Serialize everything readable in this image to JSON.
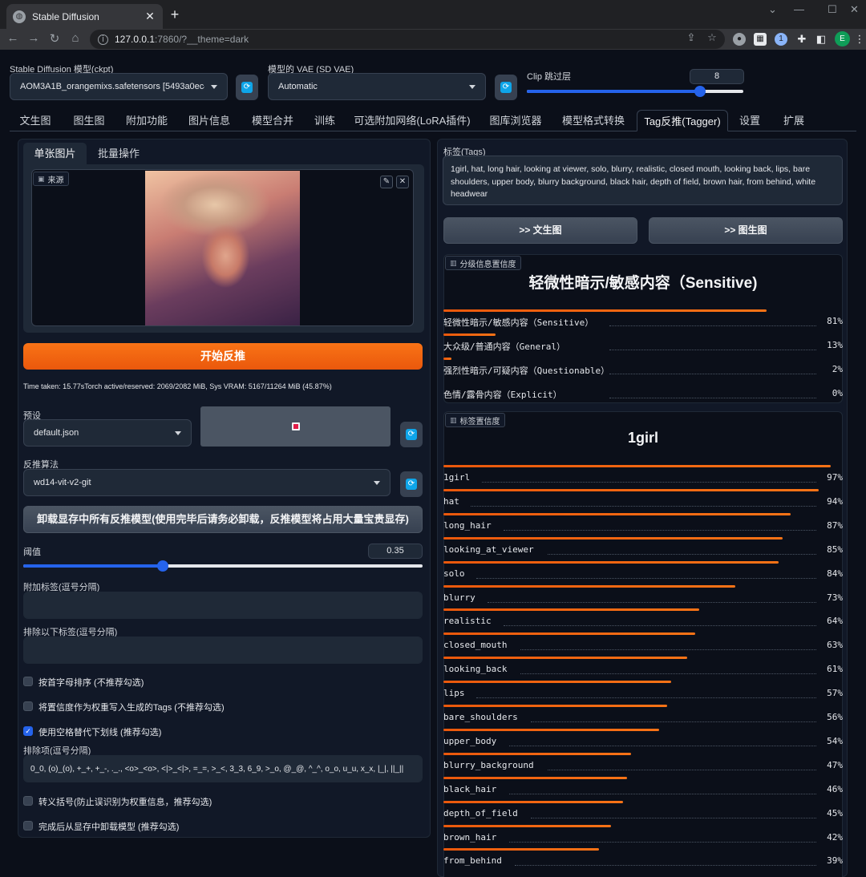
{
  "browser": {
    "tab_title": "Stable Diffusion",
    "url_host": "127.0.0.1",
    "url_rest": ":7860/?__theme=dark",
    "avatar_letter": "E"
  },
  "top": {
    "ckpt_label": "Stable Diffusion 模型(ckpt)",
    "ckpt_value": "AOM3A1B_orangemixs.safetensors [5493a0ec49",
    "vae_label": "模型的 VAE (SD VAE)",
    "vae_value": "Automatic",
    "clip_label": "Clip 跳过层",
    "clip_value": "8",
    "clip_level": 0.8
  },
  "tabs": [
    "文生图",
    "图生图",
    "附加功能",
    "图片信息",
    "模型合并",
    "训练",
    "可选附加网络(LoRA插件)",
    "图库浏览器",
    "模型格式转换",
    "Tag反推(Tagger)",
    "设置",
    "扩展"
  ],
  "left": {
    "subtabs": [
      "单张图片",
      "批量操作"
    ],
    "source_chip": "来源",
    "interrogate_button": "开始反推",
    "time_info": "Time taken: 15.77sTorch active/reserved: 2069/2082 MiB, Sys VRAM: 5167/11264 MiB (45.87%)",
    "preset_label": "预设",
    "preset_value": "default.json",
    "algo_label": "反推算法",
    "algo_value": "wd14-vit-v2-git",
    "unload_button": "卸载显存中所有反推模型(使用完毕后请务必卸载，反推模型将占用大量宝贵显存)",
    "threshold_label": "阈值",
    "threshold_value": "0.35",
    "additional_label": "附加标签(逗号分隔)",
    "exclude_label": "排除以下标签(逗号分隔)",
    "checkboxes": [
      {
        "label": "按首字母排序 (不推荐勾选)",
        "checked": false
      },
      {
        "label": "将置信度作为权重写入生成的Tags (不推荐勾选)",
        "checked": false
      },
      {
        "label": "使用空格替代下划线 (推荐勾选)",
        "checked": true
      }
    ],
    "escape_label": "排除项(逗号分隔)",
    "escape_value": "0_0, (o)_(o), +_+, +_-, ._., <o>_<o>, <|>_<|>, =_=, >_<, 3_3, 6_9, >_o, @_@, ^_^, o_o, u_u, x_x, |_|, ||_||",
    "checkboxes2": [
      {
        "label": "转义括号(防止误识别为权重信息，推荐勾选)",
        "checked": false
      },
      {
        "label": "完成后从显存中卸载模型 (推荐勾选)",
        "checked": false
      }
    ]
  },
  "right": {
    "tags_label": "标签(Tags)",
    "tags_text": "1girl, hat, long hair, looking at viewer, solo, blurry, realistic, closed mouth, looking back, lips, bare shoulders, upper body, blurry background, black hair, depth of field, brown hair, from behind, white headwear",
    "to_txt2img": ">> 文生图",
    "to_img2img": ">> 图生图",
    "rating_chip": "分级信息置信度",
    "rating_title": "轻微性暗示/敏感内容（Sensitive)",
    "ratings": [
      {
        "label": "轻微性暗示/敏感内容（Sensitive）",
        "pct": "81%",
        "value": 0.81
      },
      {
        "label": "大众级/普通内容（General）",
        "pct": "13%",
        "value": 0.13
      },
      {
        "label": "强烈性暗示/可疑内容（Questionable）",
        "pct": "2%",
        "value": 0.02
      },
      {
        "label": "色情/露骨内容（Explicit）",
        "pct": "0%",
        "value": 0.0
      }
    ],
    "tag_chip": "标签置信度",
    "tag_title": "1girl",
    "tag_rows": [
      {
        "label": "1girl",
        "pct": "97%",
        "value": 0.97
      },
      {
        "label": "hat",
        "pct": "94%",
        "value": 0.94
      },
      {
        "label": "long_hair",
        "pct": "87%",
        "value": 0.87
      },
      {
        "label": "looking_at_viewer",
        "pct": "85%",
        "value": 0.85
      },
      {
        "label": "solo",
        "pct": "84%",
        "value": 0.84
      },
      {
        "label": "blurry",
        "pct": "73%",
        "value": 0.73
      },
      {
        "label": "realistic",
        "pct": "64%",
        "value": 0.64
      },
      {
        "label": "closed_mouth",
        "pct": "63%",
        "value": 0.63
      },
      {
        "label": "looking_back",
        "pct": "61%",
        "value": 0.61
      },
      {
        "label": "lips",
        "pct": "57%",
        "value": 0.57
      },
      {
        "label": "bare_shoulders",
        "pct": "56%",
        "value": 0.56
      },
      {
        "label": "upper_body",
        "pct": "54%",
        "value": 0.54
      },
      {
        "label": "blurry_background",
        "pct": "47%",
        "value": 0.47
      },
      {
        "label": "black_hair",
        "pct": "46%",
        "value": 0.46
      },
      {
        "label": "depth_of_field",
        "pct": "45%",
        "value": 0.45
      },
      {
        "label": "brown_hair",
        "pct": "42%",
        "value": 0.42
      },
      {
        "label": "from_behind",
        "pct": "39%",
        "value": 0.39
      }
    ]
  },
  "colors": {
    "accent": "#ea580c",
    "slider": "#2563eb",
    "bg": "#0b0f19",
    "panel": "#111827"
  }
}
